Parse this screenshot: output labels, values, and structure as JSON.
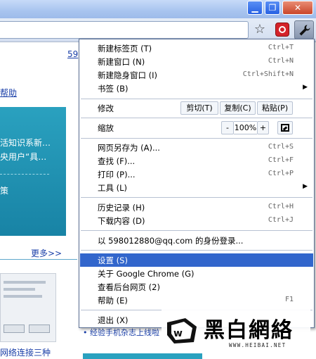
{
  "window": {
    "min_glyph": "▁",
    "max_glyph": "❐",
    "close_glyph": "✕"
  },
  "page": {
    "top_link": "59",
    "help_link": "帮助",
    "box_line1": "活知识系新…",
    "box_line2": "央用户“具…",
    "box_line3": "策",
    "more_link": "更多>>",
    "bullet_link": "• 经验手机杂志上线啦",
    "bottom_link": "网络连接三种"
  },
  "menu": {
    "items": [
      {
        "label": "新建标签页 (T)",
        "shortcut": "Ctrl+T"
      },
      {
        "label": "新建窗口 (N)",
        "shortcut": "Ctrl+N"
      },
      {
        "label": "新建隐身窗口 (I)",
        "shortcut": "Ctrl+Shift+N"
      },
      {
        "label": "书签 (B)",
        "submenu_arrow": "▶"
      },
      {
        "label": "修改"
      },
      {
        "label": "缩放"
      },
      {
        "label": "网页另存为 (A)...",
        "shortcut": "Ctrl+S"
      },
      {
        "label": "查找 (F)...",
        "shortcut": "Ctrl+F"
      },
      {
        "label": "打印 (P)...",
        "shortcut": "Ctrl+P"
      },
      {
        "label": "工具 (L)",
        "submenu_arrow": "▶"
      },
      {
        "label": "历史记录 (H)",
        "shortcut": "Ctrl+H"
      },
      {
        "label": "下载内容 (D)",
        "shortcut": "Ctrl+J"
      },
      {
        "label": "以 598012880@qq.com 的身份登录..."
      },
      {
        "label": "设置 (S)"
      },
      {
        "label": "关于 Google Chrome (G)"
      },
      {
        "label": "查看后台网页 (2)"
      },
      {
        "label": "帮助 (E)",
        "shortcut": "F1"
      },
      {
        "label": "退出 (X)"
      }
    ],
    "edit": {
      "cut": "剪切(T)",
      "copy": "复制(C)",
      "paste": "粘贴(P)"
    },
    "zoom": {
      "minus": "-",
      "value": "100%",
      "plus": "+"
    }
  },
  "watermark": {
    "cn": "黑白網絡",
    "url": "WWW.HEIBAI.NET"
  },
  "colors": {
    "highlight": "#3266cc",
    "link": "#1a3fa8",
    "page_box": "#2aa1bf"
  }
}
